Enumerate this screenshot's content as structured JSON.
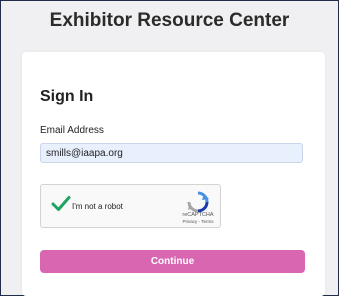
{
  "page": {
    "title": "Exhibitor Resource Center"
  },
  "signin": {
    "heading": "Sign In",
    "email_label": "Email Address",
    "email_value": "smills@iaapa.org"
  },
  "recaptcha": {
    "label": "I'm not a robot",
    "brand": "reCAPTCHA",
    "privacy": "Privacy",
    "separator": " - ",
    "terms": "Terms",
    "check_icon": "checkmark-icon",
    "logo_icon": "recaptcha-logo-icon"
  },
  "actions": {
    "continue_label": "Continue"
  },
  "colors": {
    "accent": "#d966b0",
    "input_bg": "#e8f0fe",
    "check": "#1ea362"
  }
}
